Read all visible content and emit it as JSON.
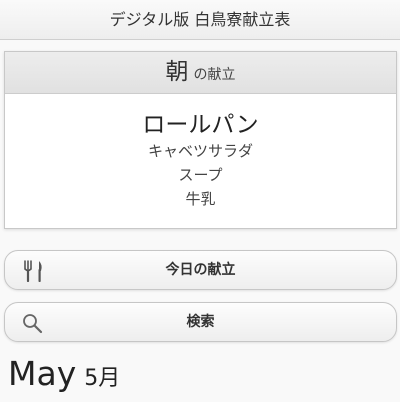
{
  "header": {
    "title": "デジタル版 白鳥寮献立表"
  },
  "menu_card": {
    "meal": "朝",
    "meal_suffix": "の献立",
    "main_dish": "ロールパン",
    "side_items": [
      "キャベツサラダ",
      "スープ",
      "牛乳"
    ]
  },
  "buttons": {
    "today_label": "今日の献立",
    "today_icon": "fork-knife-icon",
    "search_label": "検索",
    "search_icon": "search-icon"
  },
  "month": {
    "english": "May",
    "japanese": "5月"
  }
}
